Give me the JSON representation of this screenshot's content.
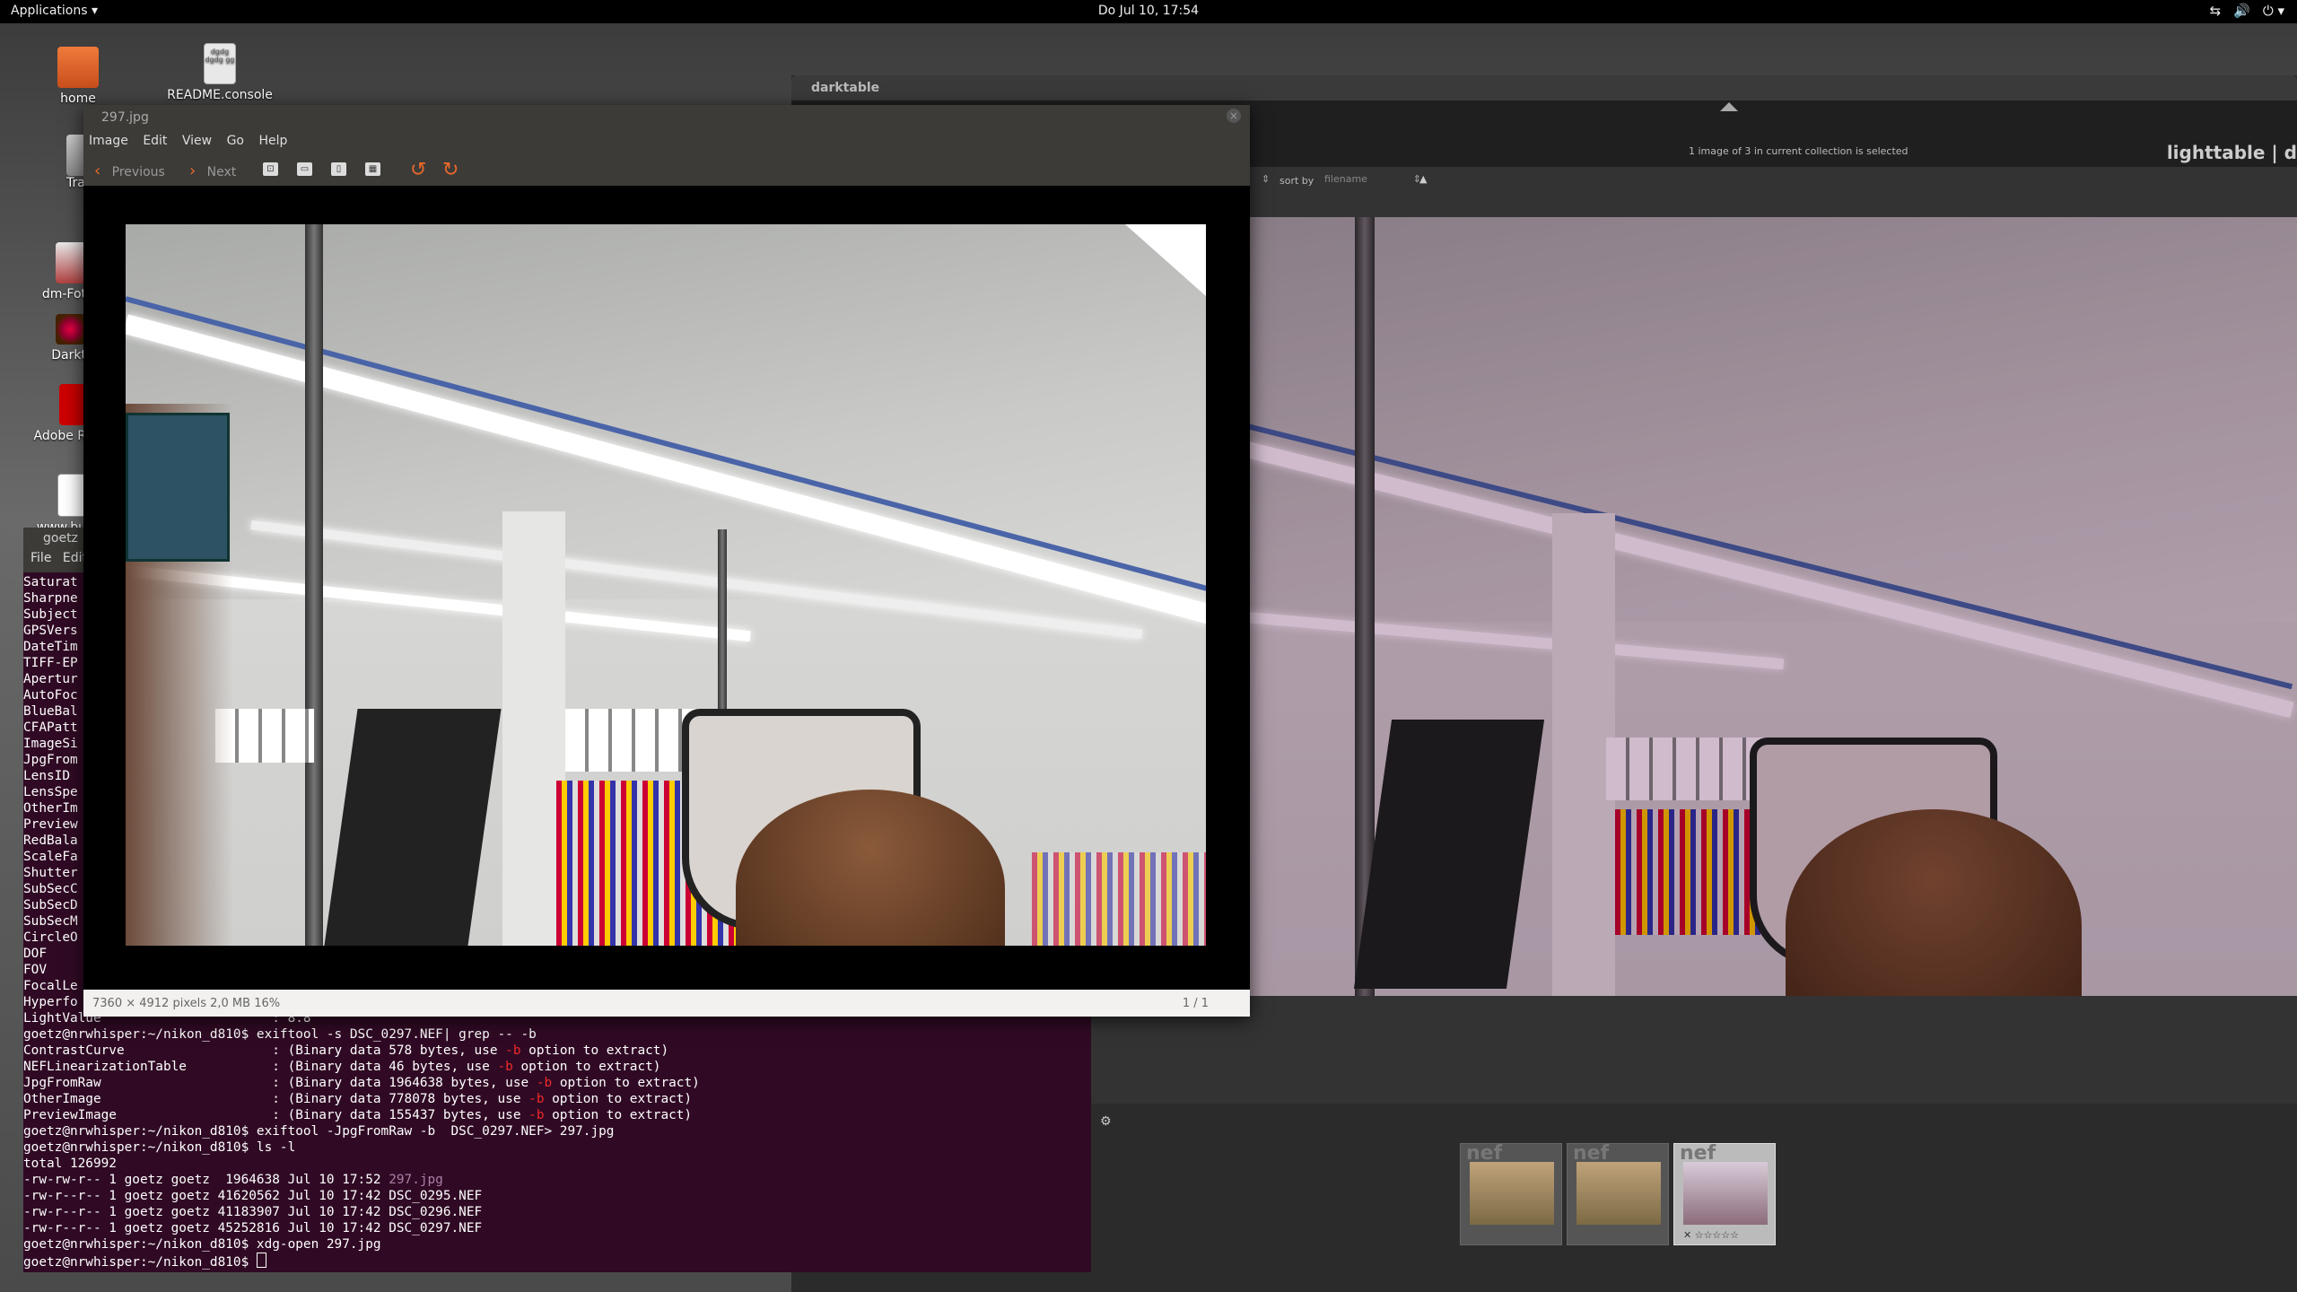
{
  "topbar": {
    "applications": "Applications ▾",
    "clock": "Do Jul 10, 17:54",
    "tray_icons": [
      "network-icon",
      "volume-icon",
      "power-icon"
    ]
  },
  "desktop": {
    "icons": [
      {
        "label": "home"
      },
      {
        "label": "README.console"
      },
      {
        "label": "Tra"
      },
      {
        "label": "dm-Fot"
      },
      {
        "label": "Darkt"
      },
      {
        "label": "Adobe R"
      },
      {
        "label": "www.bu"
      }
    ]
  },
  "darktable": {
    "title": "darktable",
    "selection_info": "1 image of 3 in current collection is selected",
    "module": "lighttable  |  d",
    "sort_label": "sort by",
    "sort_value": "filename",
    "sort_dir": "▲",
    "thumbs": [
      {
        "ext": "nef",
        "selected": false
      },
      {
        "ext": "nef",
        "selected": false
      },
      {
        "ext": "nef",
        "selected": true,
        "stars": "✕  ☆☆☆☆☆"
      }
    ]
  },
  "terminal": {
    "title": "goetz",
    "menu": [
      "File",
      "Edit"
    ],
    "left_column": [
      "Saturat",
      "Sharpne",
      "Subject",
      "GPSVers",
      "DateTim",
      "TIFF-EP",
      "Apertur",
      "AutoFoc",
      "BlueBal",
      "CFAPatt",
      "ImageSi",
      "JpgFrom",
      "LensID",
      "LensSpe",
      "OtherIm",
      "Preview",
      "RedBala",
      "ScaleFa",
      "Shutter",
      "SubSecC",
      "SubSecD",
      "SubSecM",
      "CircleO",
      "DOF",
      "FOV",
      "FocalLe",
      "Hyperfo"
    ],
    "lines": [
      {
        "text": "LightValue                      : 8.8"
      },
      {
        "text": "goetz@nrwhisper:~/nikon_d810$ exiftool -s DSC_0297.NEF| grep -- -b"
      },
      {
        "pre": "ContrastCurve                   : (Binary data 578 bytes, use ",
        "red": "-b",
        "post": " option to extract)"
      },
      {
        "pre": "NEFLinearizationTable           : (Binary data 46 bytes, use ",
        "red": "-b",
        "post": " option to extract)"
      },
      {
        "pre": "JpgFromRaw                      : (Binary data 1964638 bytes, use ",
        "red": "-b",
        "post": " option to extract)"
      },
      {
        "pre": "OtherImage                      : (Binary data 778078 bytes, use ",
        "red": "-b",
        "post": " option to extract)"
      },
      {
        "pre": "PreviewImage                    : (Binary data 155437 bytes, use ",
        "red": "-b",
        "post": " option to extract)"
      },
      {
        "text": "goetz@nrwhisper:~/nikon_d810$ exiftool -JpgFromRaw -b  DSC_0297.NEF> 297.jpg"
      },
      {
        "text": "goetz@nrwhisper:~/nikon_d810$ ls -l"
      },
      {
        "text": "total 126992"
      },
      {
        "pre": "-rw-rw-r-- 1 goetz goetz  1964638 Jul 10 17:52 ",
        "purple": "297.jpg",
        "post": ""
      },
      {
        "text": "-rw-r--r-- 1 goetz goetz 41620562 Jul 10 17:42 DSC_0295.NEF"
      },
      {
        "text": "-rw-r--r-- 1 goetz goetz 41183907 Jul 10 17:42 DSC_0296.NEF"
      },
      {
        "text": "-rw-r--r-- 1 goetz goetz 45252816 Jul 10 17:42 DSC_0297.NEF"
      },
      {
        "text": "goetz@nrwhisper:~/nikon_d810$ xdg-open 297.jpg"
      },
      {
        "text": "goetz@nrwhisper:~/nikon_d810$ "
      }
    ]
  },
  "viewer": {
    "title": "297.jpg",
    "menu": [
      "Image",
      "Edit",
      "View",
      "Go",
      "Help"
    ],
    "previous": "Previous",
    "next": "Next",
    "status_left": "7360 × 4912 pixels  2,0 MB   16%",
    "status_right": "1 / 1"
  },
  "colors": {
    "terminal_bg": "#300a24",
    "accent_orange": "#e9682a",
    "darktable_tint": "#6c5467"
  }
}
